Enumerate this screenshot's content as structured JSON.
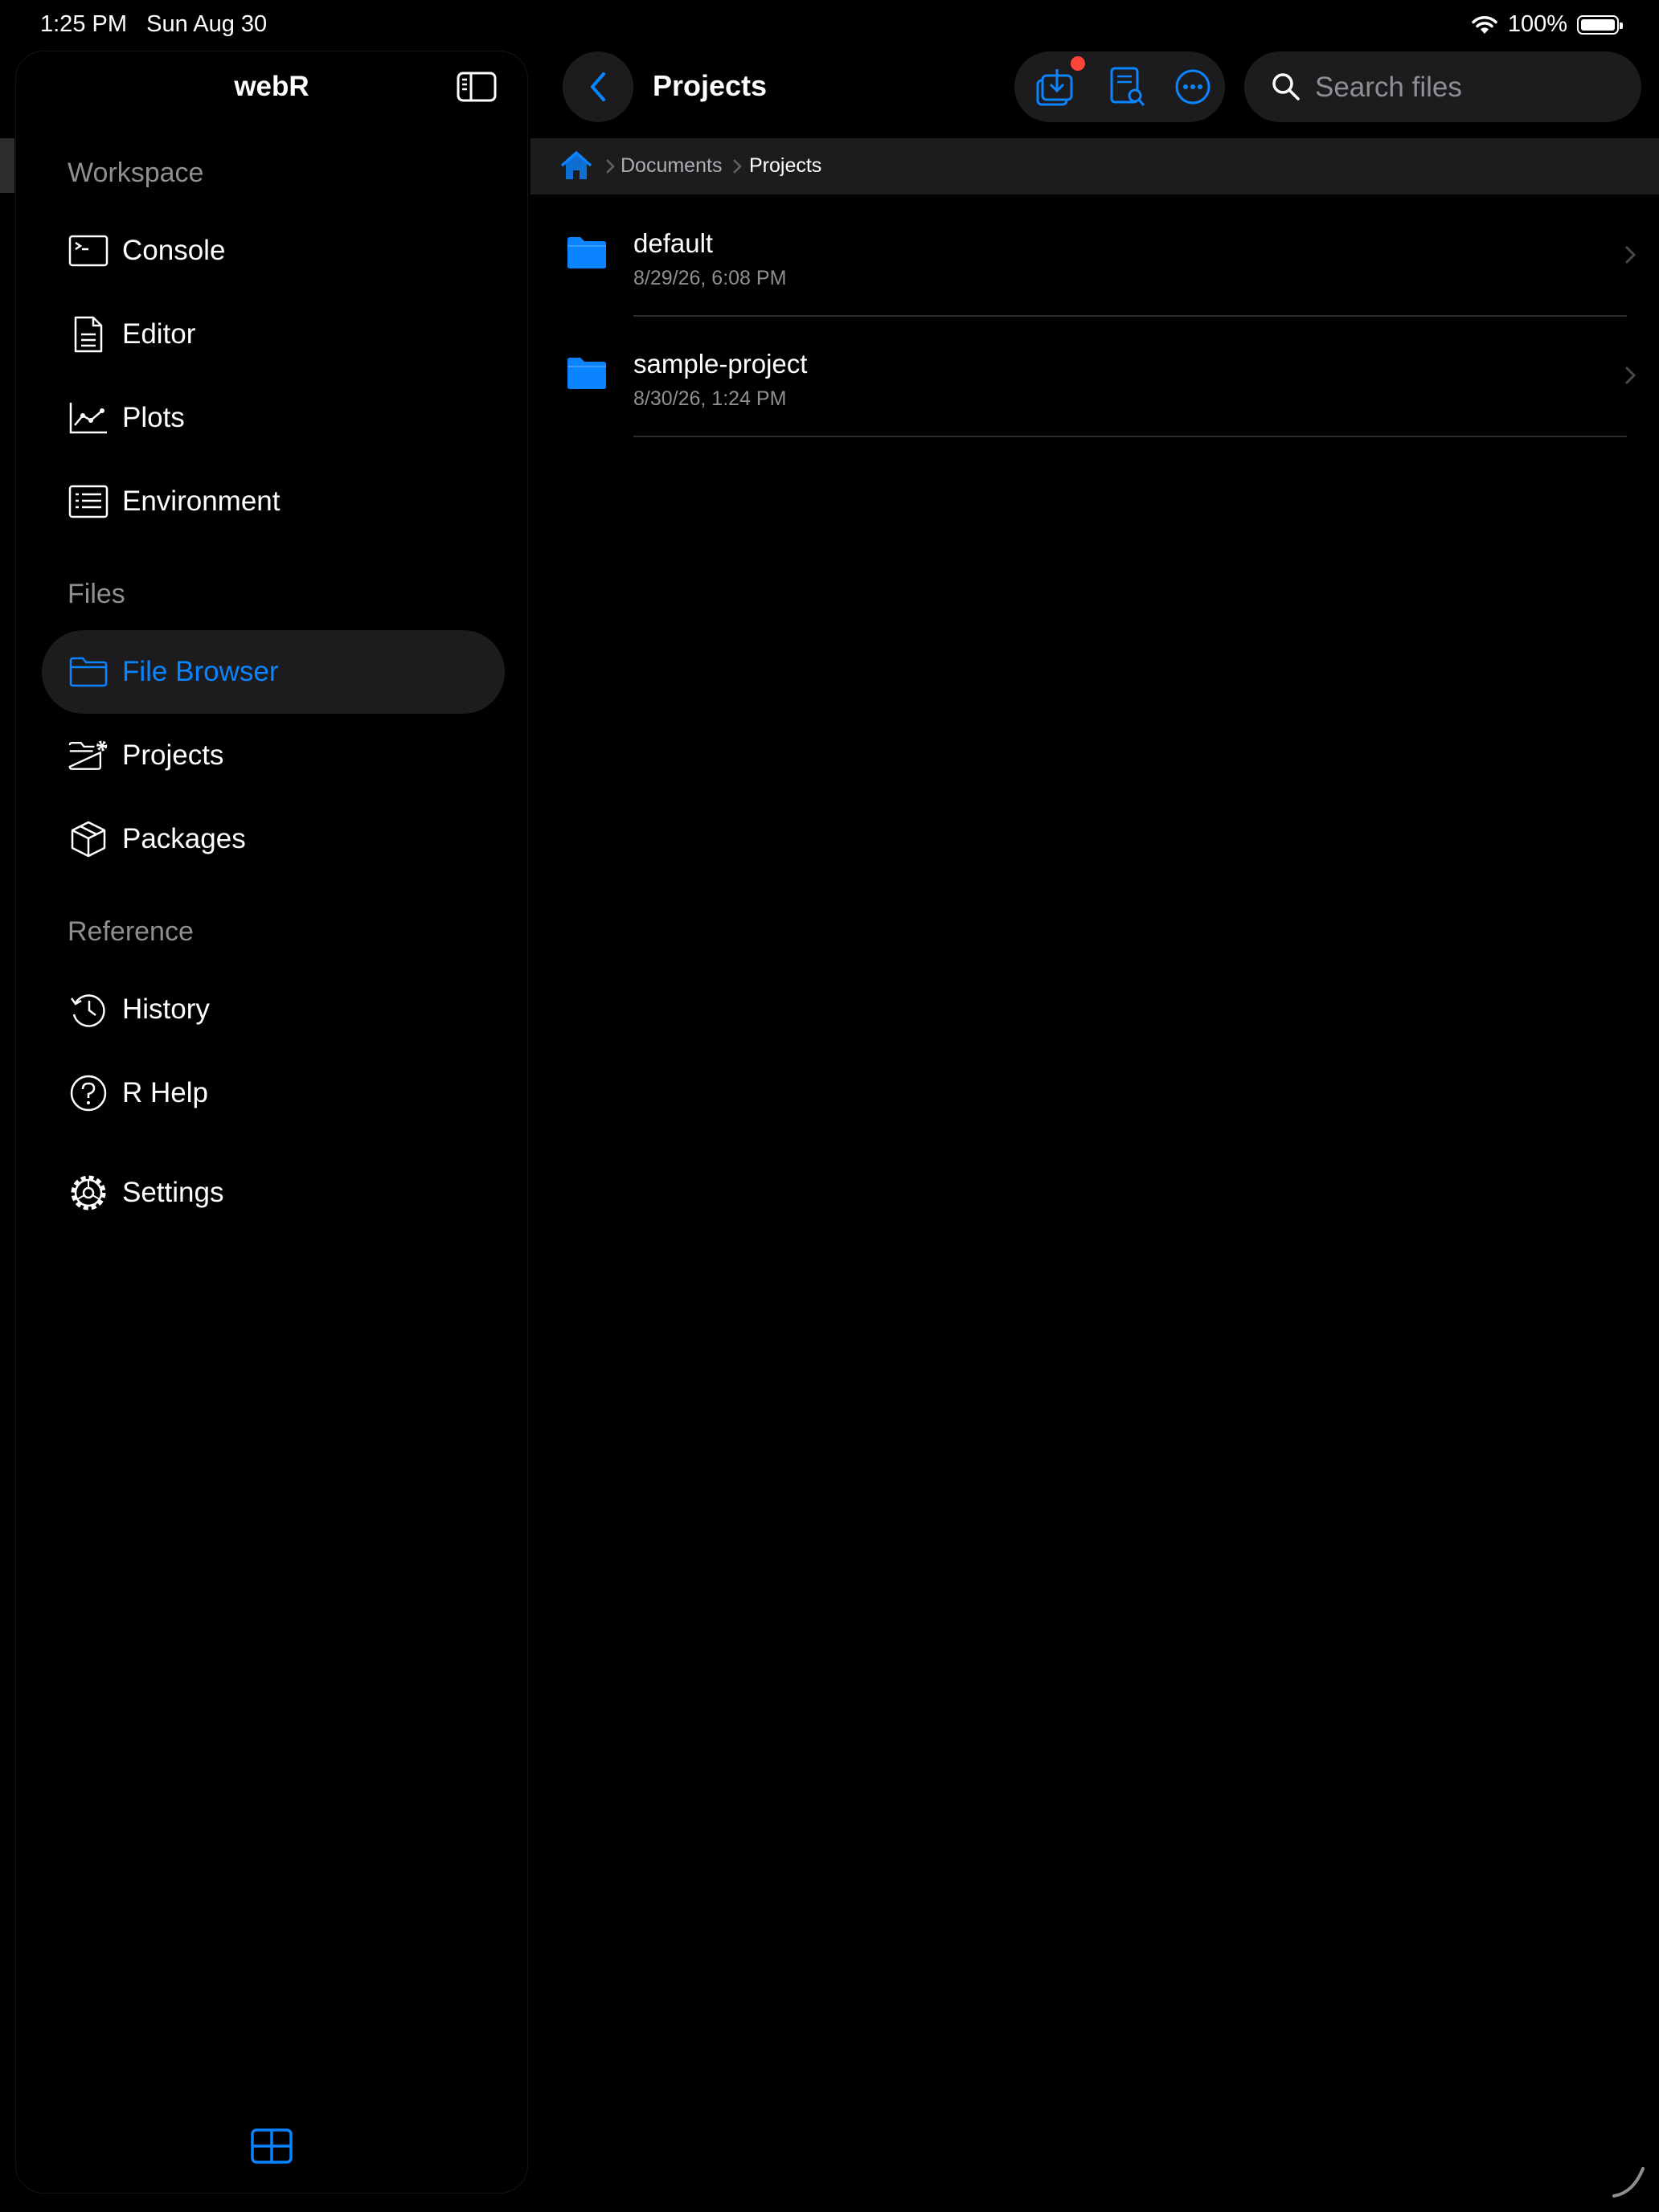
{
  "status_bar": {
    "time": "1:25 PM",
    "date": "Sun Aug 30",
    "battery": "100%"
  },
  "sidebar": {
    "title": "webR",
    "sections": [
      {
        "label": "Workspace"
      },
      {
        "label": "Files"
      },
      {
        "label": "Reference"
      }
    ],
    "items": [
      {
        "label": "Console",
        "icon": "terminal-icon"
      },
      {
        "label": "Editor",
        "icon": "document-icon"
      },
      {
        "label": "Plots",
        "icon": "chart-line-icon"
      },
      {
        "label": "Environment",
        "icon": "list-icon"
      },
      {
        "label": "File Browser",
        "icon": "folder-icon",
        "active": true
      },
      {
        "label": "Projects",
        "icon": "folder-gear-icon"
      },
      {
        "label": "Packages",
        "icon": "package-icon"
      },
      {
        "label": "History",
        "icon": "history-icon"
      },
      {
        "label": "R Help",
        "icon": "help-icon"
      },
      {
        "label": "Settings",
        "icon": "gear-icon"
      }
    ]
  },
  "header": {
    "title": "Projects",
    "search_placeholder": "Search files"
  },
  "breadcrumb": {
    "items": [
      "Documents",
      "Projects"
    ]
  },
  "files": [
    {
      "name": "default",
      "date": "8/29/26, 6:08 PM"
    },
    {
      "name": "sample-project",
      "date": "8/30/26, 1:24 PM"
    }
  ],
  "colors": {
    "accent": "#0a84ff",
    "background": "#000000",
    "surface": "#1c1c1e",
    "badge": "#ff453a"
  }
}
